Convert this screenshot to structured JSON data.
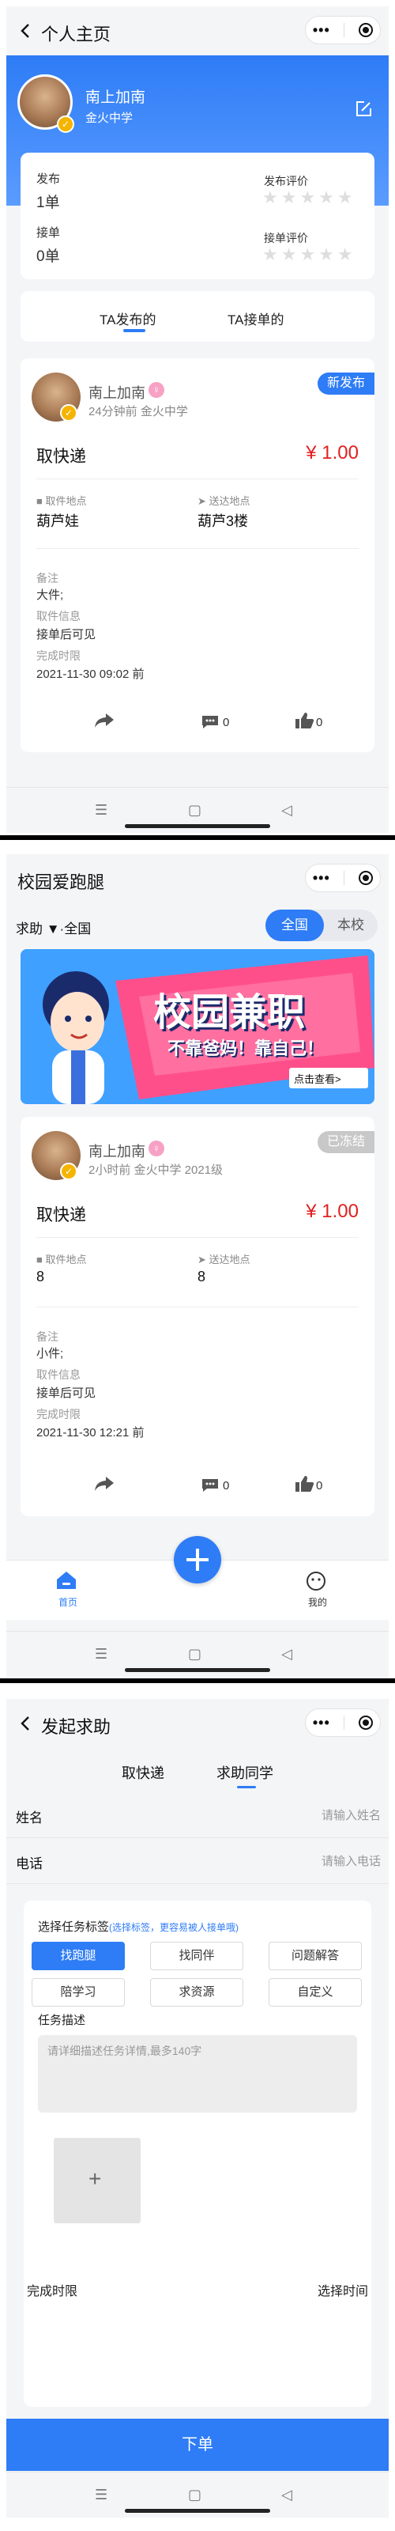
{
  "profile": {
    "nav_title": "个人主页",
    "name": "南上加南",
    "school": "金火中学",
    "stats": {
      "publish_label": "发布",
      "publish_value": "1单",
      "accept_label": "接单",
      "accept_value": "0单",
      "publish_rating_label": "发布评价",
      "accept_rating_label": "接单评价"
    },
    "tabs": [
      "TA发布的",
      "TA接单的"
    ],
    "order": {
      "name": "南上加南",
      "meta": "24分钟前 金火中学",
      "badge": "新发布",
      "type": "取快递",
      "price": "¥ 1.00",
      "pickup_label": "取件地点",
      "pickup_value": "葫芦娃",
      "dropoff_label": "送达地点",
      "dropoff_value": "葫芦3楼",
      "remark_label": "备注",
      "remark_value": "大件;",
      "info_label": "取件信息",
      "info_value": "接单后可见",
      "deadline_label": "完成时限",
      "deadline_value": "2021-11-30 09:02 前",
      "comments": "0",
      "likes": "0"
    }
  },
  "home": {
    "nav_title": "校园爱跑腿",
    "filter": "求助 ▼·全国",
    "segment": [
      "全国",
      "本校"
    ],
    "banner": {
      "title": "校园兼职",
      "subtitle": "不靠爸妈！靠自己！",
      "button": "点击查看>"
    },
    "order": {
      "name": "南上加南",
      "meta": "2小时前 金火中学 2021级",
      "badge": "已冻结",
      "type": "取快递",
      "price": "¥ 1.00",
      "pickup_label": "取件地点",
      "pickup_value": "8",
      "dropoff_label": "送达地点",
      "dropoff_value": "8",
      "remark_label": "备注",
      "remark_value": "小件;",
      "info_label": "取件信息",
      "info_value": "接单后可见",
      "deadline_label": "完成时限",
      "deadline_value": "2021-11-30 12:21 前",
      "comments": "0",
      "likes": "0"
    },
    "tabbar": {
      "home_label": "首页",
      "mine_label": "我的"
    }
  },
  "request": {
    "nav_title": "发起求助",
    "tabs": [
      "取快递",
      "求助同学"
    ],
    "name_label": "姓名",
    "name_placeholder": "请输入姓名",
    "phone_label": "电话",
    "phone_placeholder": "请输入电话",
    "tags_title": "选择任务标签",
    "tags_hint": "(选择标签，更容易被人接单哦)",
    "tags": [
      "找跑腿",
      "找同伴",
      "问题解答",
      "陪学习",
      "求资源",
      "自定义"
    ],
    "desc_label": "任务描述",
    "desc_placeholder": "请详细描述任务详情,最多140字",
    "upload_symbol": "+",
    "deadline_label": "完成时限",
    "deadline_value": "选择时间",
    "submit": "下单"
  },
  "colors": {
    "accent": "#2e7cf6",
    "price": "#e02020",
    "badge_new": "#2e7cf6",
    "badge_frozen": "#c8c8c8"
  }
}
